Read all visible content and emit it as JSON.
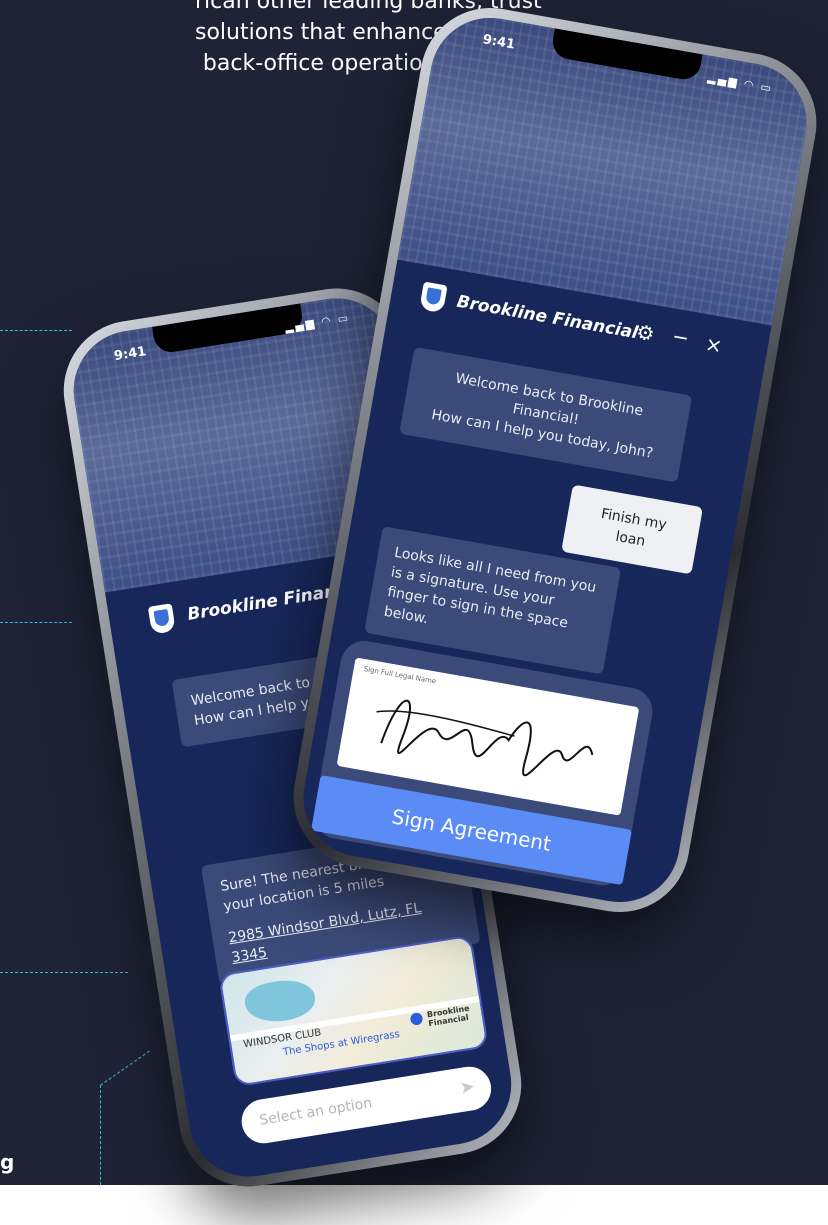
{
  "intro": {
    "lines": [
      "rican other leading banks, trust",
      "solutions that enhance both",
      "back-office operations."
    ]
  },
  "sidebar": {
    "letter": "g"
  },
  "phone_front": {
    "time": "9:41",
    "brand": "Brookline Financial",
    "welcome": "Welcome back to Brookline Financial!\nHow can I help you today, John?",
    "user_message": "Finish my loan",
    "bot_message": "Looks like all I need from you is a signature. Use your finger to sign in the space below.",
    "signature_label": "Sign Full Legal Name",
    "sign_button": "Sign Agreement",
    "icons": [
      "settings-icon",
      "minimize-icon",
      "close-icon"
    ]
  },
  "phone_back": {
    "time": "9:41",
    "brand": "Brookline Financial",
    "welcome": "Welcome back to Brookline Fin\nHow can I help you today, Joh",
    "bot_message": "Sure! The nearest bran\nyour location is 5 miles",
    "address": "2985 Windsor Blvd, Lutz, FL 3345",
    "map": {
      "label_area": "WINDSOR CLUB",
      "label_shops": "The Shops at Wiregrass",
      "label_pin": "Brookline Financial"
    },
    "select_placeholder": "Select an option"
  },
  "colors": {
    "background": "#1f2336",
    "screen": "#18275a",
    "bubble": "#3b4a78",
    "button": "#5b8cf5",
    "dash": "#3fb8d8"
  }
}
